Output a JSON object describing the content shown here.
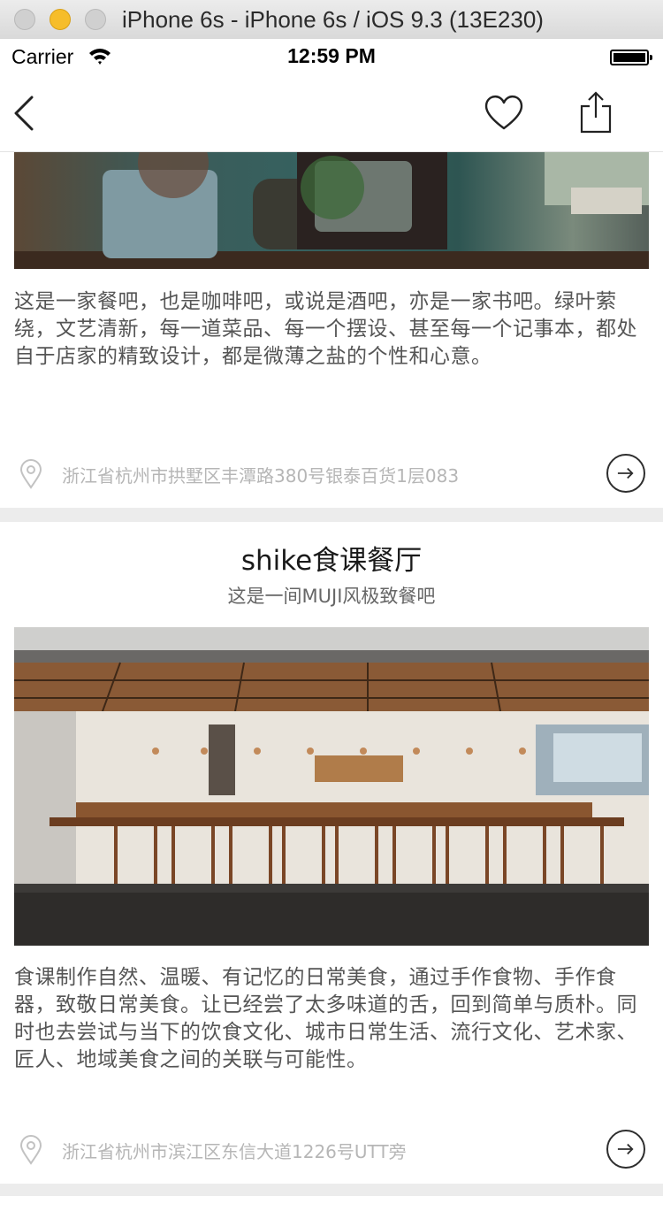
{
  "simulator": {
    "title": "iPhone 6s - iPhone 6s / iOS 9.3 (13E230)"
  },
  "status_bar": {
    "carrier": "Carrier",
    "time": "12:59 PM"
  },
  "nav": {
    "back_icon": "chevron-left-icon",
    "favorite_icon": "heart-outline-icon",
    "share_icon": "share-icon"
  },
  "cards": [
    {
      "description": "这是一家餐吧，也是咖啡吧，或说是酒吧，亦是一家书吧。绿叶萦绕，文艺清新，每一道菜品、每一个摆设、甚至每一个记事本，都处自于店家的精致设计，都是微薄之盐的个性和心意。",
      "address": "浙江省杭州市拱墅区丰潭路380号银泰百货1层083"
    },
    {
      "title": "shike食课餐厅",
      "subtitle": "这是一间MUJI风极致餐吧",
      "description": "食课制作自然、温暖、有记忆的日常美食，通过手作食物、手作食器，致敬日常美食。让已经尝了太多味道的舌，回到简单与质朴。同时也去尝试与当下的饮食文化、城市日常生活、流行文化、艺术家、匠人、地域美食之间的关联与可能性。",
      "address": "浙江省杭州市滨江区东信大道1226号UTT旁"
    }
  ],
  "colors": {
    "separator": "#ececec",
    "address_text": "#b6b6b6",
    "description_text": "#555555"
  }
}
